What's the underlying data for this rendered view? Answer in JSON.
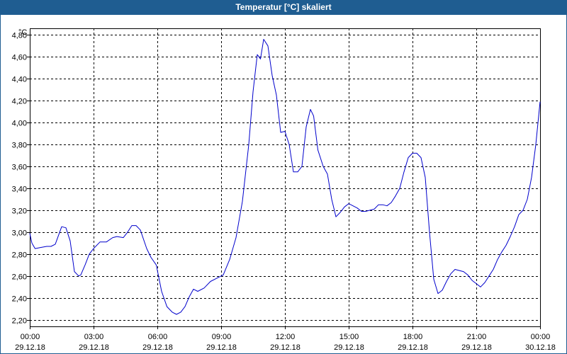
{
  "window": {
    "title": "Temperatur [°C] skaliert"
  },
  "colors": {
    "title_bar": "#1f5d91",
    "line": "#0000cc",
    "grid": "#000000"
  },
  "chart_data": {
    "type": "line",
    "title": "Temperatur [°C] skaliert",
    "ylabel": "°C",
    "xlabel": "",
    "grid": true,
    "grid_style": "dashed",
    "legend": "none",
    "ylim": [
      2.14,
      4.86
    ],
    "xlim_hours": [
      0,
      24
    ],
    "y_ticks": [
      2.2,
      2.4,
      2.6,
      2.8,
      3.0,
      3.2,
      3.4,
      3.6,
      3.8,
      4.0,
      4.2,
      4.4,
      4.6,
      4.8
    ],
    "y_tick_labels": [
      "2,20",
      "2,40",
      "2,60",
      "2,80",
      "3,00",
      "3,20",
      "3,40",
      "3,60",
      "3,80",
      "4,00",
      "4,20",
      "4,40",
      "4,60",
      "4,80"
    ],
    "x_ticks_hours": [
      0,
      3,
      6,
      9,
      12,
      15,
      18,
      21,
      24
    ],
    "x_tick_labels": [
      {
        "time": "00:00",
        "date": "29.12.18"
      },
      {
        "time": "03:00",
        "date": "29.12.18"
      },
      {
        "time": "06:00",
        "date": "29.12.18"
      },
      {
        "time": "09:00",
        "date": "29.12.18"
      },
      {
        "time": "12:00",
        "date": "29.12.18"
      },
      {
        "time": "15:00",
        "date": "29.12.18"
      },
      {
        "time": "18:00",
        "date": "29.12.18"
      },
      {
        "time": "21:00",
        "date": "29.12.18"
      },
      {
        "time": "00:00",
        "date": "30.12.18"
      }
    ],
    "series": [
      {
        "x_hours": [
          0.0,
          0.1,
          0.25,
          0.5,
          0.8,
          1.0,
          1.2,
          1.5,
          1.7,
          1.9,
          2.1,
          2.3,
          2.4,
          2.6,
          2.8,
          3.0,
          3.3,
          3.6,
          3.9,
          4.1,
          4.4,
          4.6,
          4.8,
          5.0,
          5.2,
          5.5,
          5.7,
          5.95,
          6.2,
          6.45,
          6.7,
          6.9,
          7.1,
          7.3,
          7.5,
          7.7,
          7.9,
          8.2,
          8.5,
          8.8,
          9.1,
          9.4,
          9.7,
          10.0,
          10.3,
          10.5,
          10.7,
          10.85,
          11.0,
          11.2,
          11.4,
          11.6,
          11.8,
          12.0,
          12.2,
          12.4,
          12.6,
          12.8,
          13.0,
          13.2,
          13.35,
          13.55,
          13.8,
          14.0,
          14.2,
          14.4,
          14.6,
          14.8,
          15.0,
          15.2,
          15.4,
          15.6,
          15.8,
          16.0,
          16.2,
          16.4,
          16.6,
          16.8,
          17.0,
          17.2,
          17.4,
          17.6,
          17.8,
          18.0,
          18.2,
          18.4,
          18.6,
          18.8,
          19.0,
          19.2,
          19.4,
          19.6,
          19.8,
          20.0,
          20.2,
          20.4,
          20.6,
          20.8,
          21.0,
          21.2,
          21.4,
          21.6,
          21.8,
          22.0,
          22.2,
          22.4,
          22.6,
          22.8,
          23.0,
          23.2,
          23.4,
          23.6,
          23.8,
          24.0
        ],
        "values": [
          2.99,
          2.9,
          2.85,
          2.86,
          2.87,
          2.87,
          2.89,
          3.05,
          3.04,
          2.92,
          2.64,
          2.6,
          2.61,
          2.7,
          2.8,
          2.85,
          2.91,
          2.91,
          2.95,
          2.96,
          2.95,
          3.0,
          3.06,
          3.06,
          3.02,
          2.85,
          2.77,
          2.7,
          2.46,
          2.32,
          2.27,
          2.25,
          2.27,
          2.32,
          2.41,
          2.48,
          2.46,
          2.49,
          2.55,
          2.58,
          2.61,
          2.75,
          2.95,
          3.28,
          3.8,
          4.28,
          4.62,
          4.58,
          4.76,
          4.7,
          4.43,
          4.25,
          3.91,
          3.92,
          3.8,
          3.55,
          3.55,
          3.6,
          3.96,
          4.12,
          4.06,
          3.75,
          3.6,
          3.53,
          3.3,
          3.14,
          3.18,
          3.23,
          3.26,
          3.24,
          3.22,
          3.19,
          3.19,
          3.2,
          3.21,
          3.25,
          3.25,
          3.24,
          3.27,
          3.33,
          3.4,
          3.55,
          3.68,
          3.72,
          3.72,
          3.68,
          3.5,
          3.0,
          2.57,
          2.44,
          2.47,
          2.55,
          2.62,
          2.66,
          2.65,
          2.64,
          2.61,
          2.56,
          2.53,
          2.5,
          2.54,
          2.6,
          2.66,
          2.75,
          2.82,
          2.88,
          2.96,
          3.05,
          3.16,
          3.2,
          3.3,
          3.5,
          3.8,
          4.19
        ]
      }
    ]
  }
}
